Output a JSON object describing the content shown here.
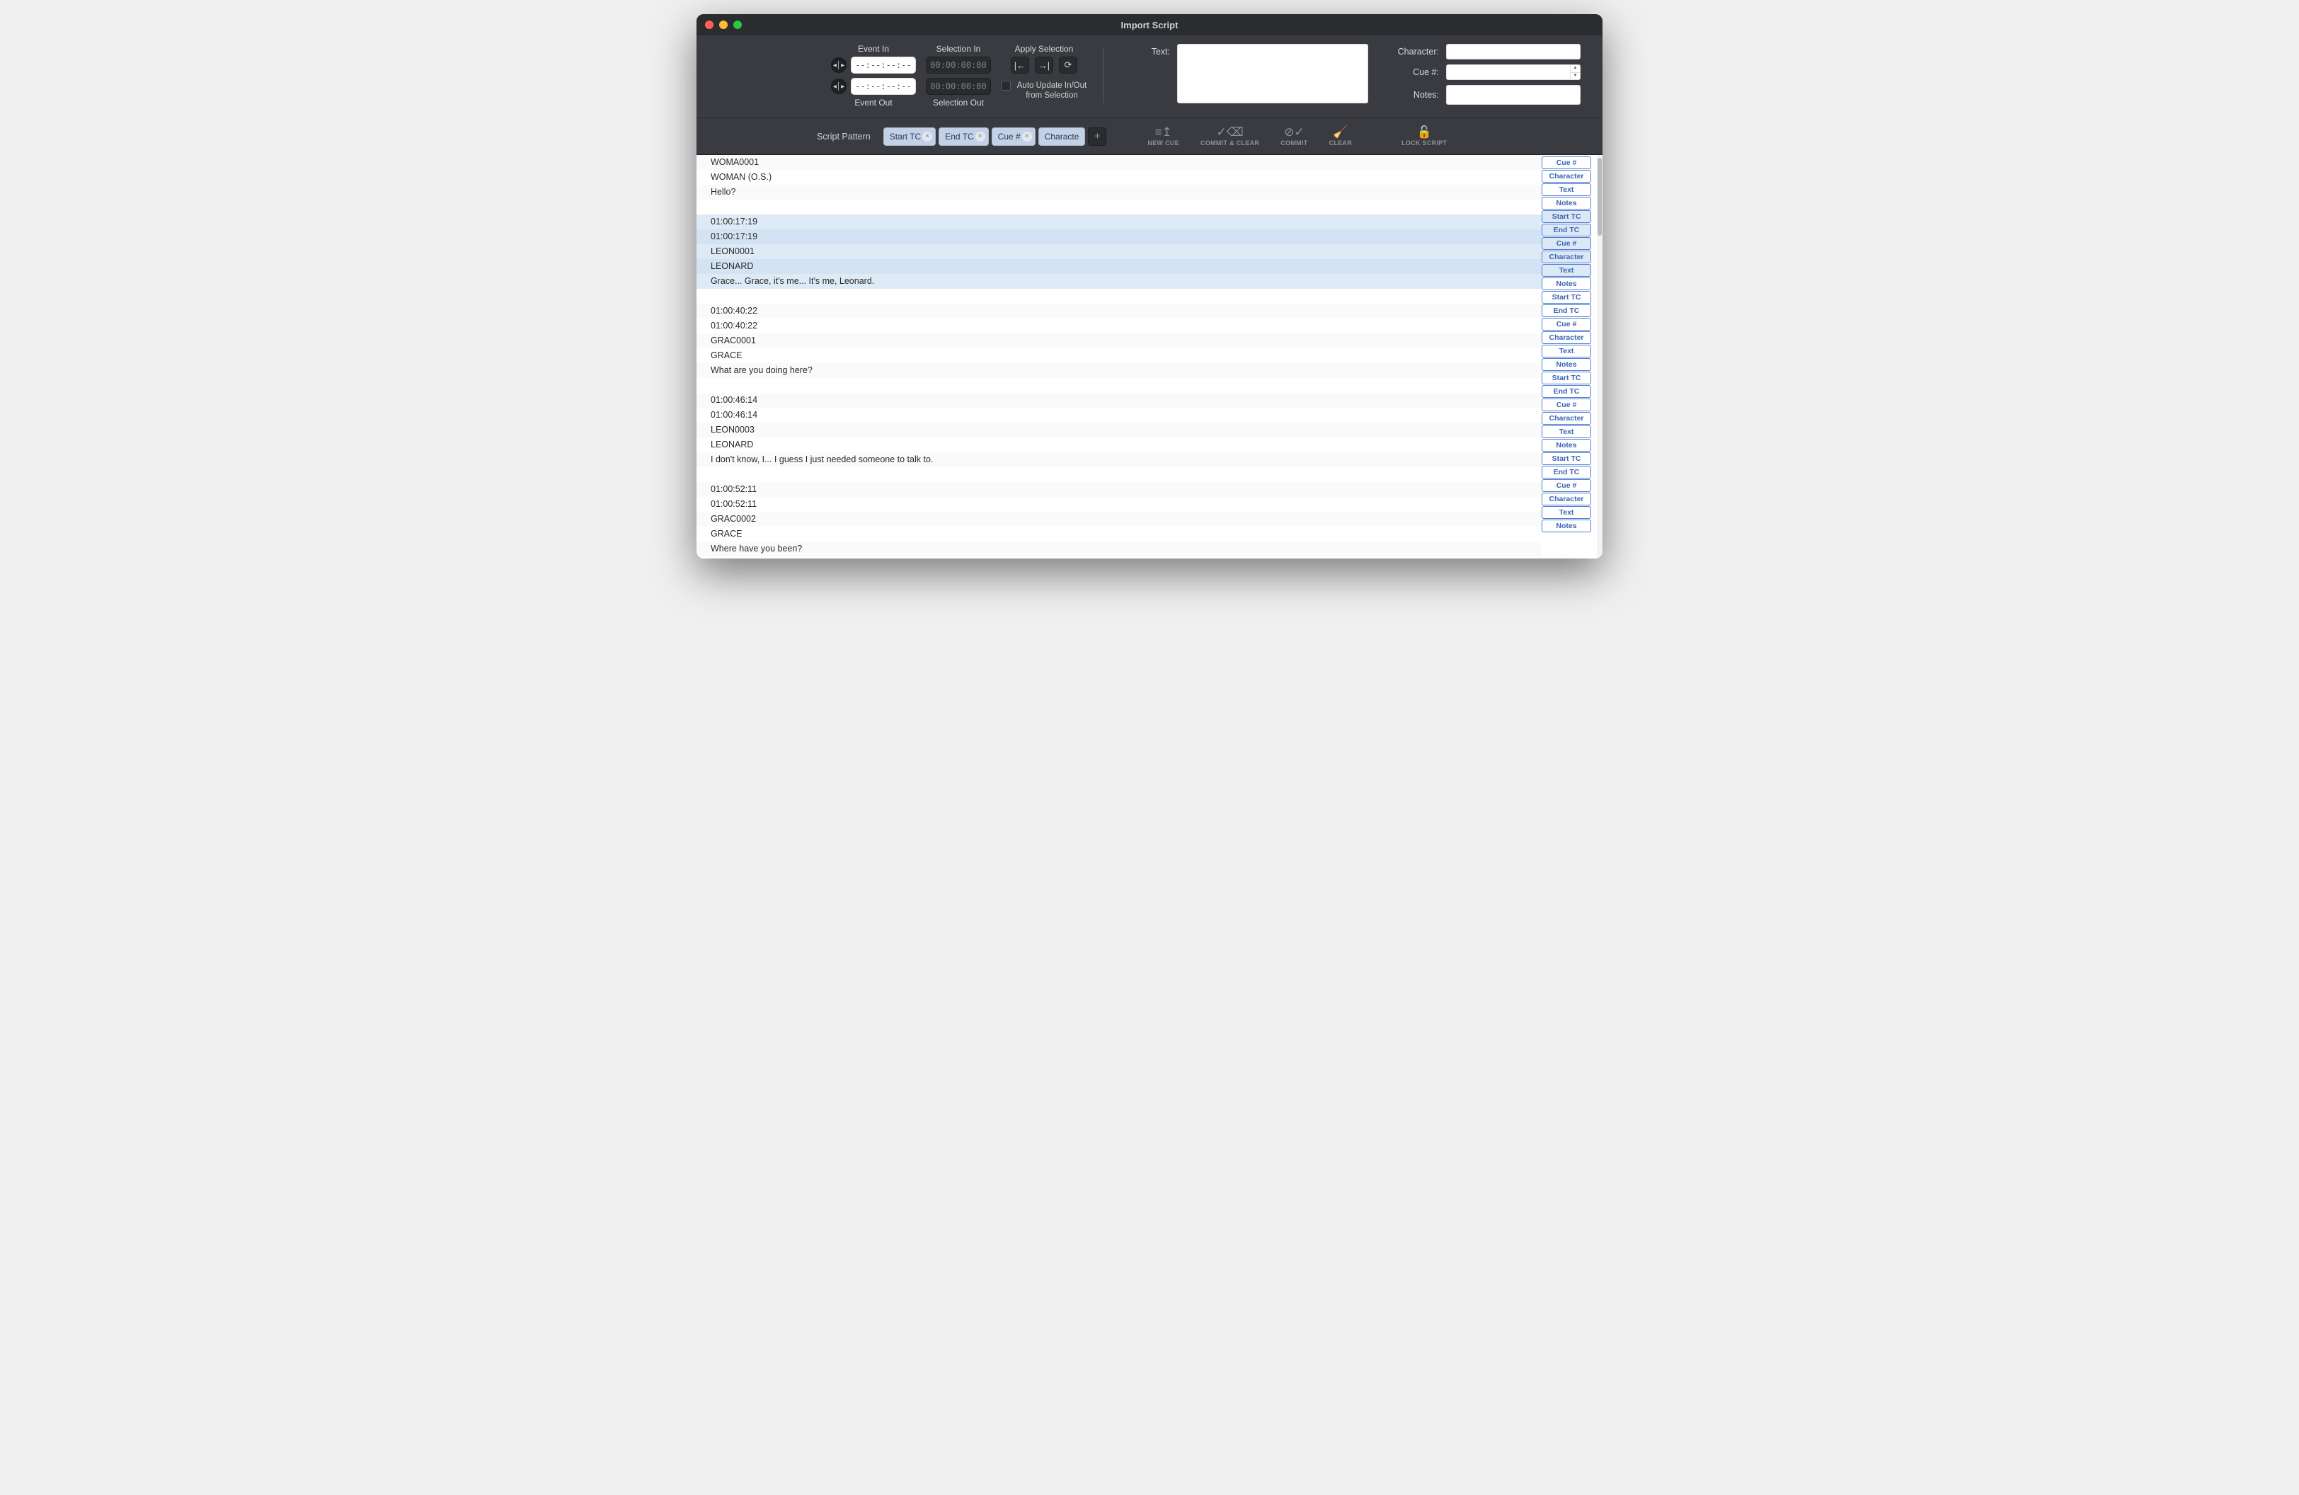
{
  "window": {
    "title": "Import Script"
  },
  "controls": {
    "event_in_label": "Event In",
    "event_out_label": "Event Out",
    "event_in_value": "--:--:--:--",
    "event_out_value": "--:--:--:--",
    "selection_in_label": "Selection In",
    "selection_out_label": "Selection Out",
    "selection_in_value": "00:00:00:00",
    "selection_out_value": "00:00:00:00",
    "apply_selection_label": "Apply Selection",
    "auto_update_label": "Auto Update In/Out from Selection",
    "text_label": "Text:",
    "character_label": "Character:",
    "cue_label": "Cue #:",
    "notes_label": "Notes:",
    "text_value": "",
    "character_value": "",
    "cue_value": "",
    "notes_value": ""
  },
  "cmdbar": {
    "pattern_label": "Script Pattern",
    "chips": [
      "Start TC",
      "End TC",
      "Cue #",
      "Characte"
    ],
    "buttons": {
      "new_cue": "NEW CUE",
      "commit_clear": "COMMIT & CLEAR",
      "commit": "COMMIT",
      "clear": "CLEAR",
      "lock": "LOCK SCRIPT"
    }
  },
  "tag_labels": [
    "Cue #",
    "Character",
    "Text",
    "Notes",
    "Start TC",
    "End TC",
    "Cue #",
    "Character",
    "Text",
    "Notes",
    "Start TC",
    "End TC",
    "Cue #",
    "Character",
    "Text",
    "Notes",
    "Start TC",
    "End TC",
    "Cue #",
    "Character",
    "Text",
    "Notes",
    "Start TC",
    "End TC",
    "Cue #",
    "Character",
    "Text",
    "Notes"
  ],
  "tag_selected_indices": [
    4,
    5,
    6,
    7,
    8
  ],
  "script_lines": [
    {
      "t": "WOMA0001"
    },
    {
      "t": "WOMAN (O.S.)"
    },
    {
      "t": "Hello?"
    },
    {
      "t": ""
    },
    {
      "t": "01:00:17:19",
      "sel": "a"
    },
    {
      "t": "01:00:17:19",
      "sel": "b"
    },
    {
      "t": "LEON0001",
      "sel": "a"
    },
    {
      "t": "LEONARD",
      "sel": "b"
    },
    {
      "t": "Grace... Grace, it's me... It's me, Leonard.",
      "sel": "a"
    },
    {
      "t": ""
    },
    {
      "t": "01:00:40:22"
    },
    {
      "t": "01:00:40:22"
    },
    {
      "t": "GRAC0001"
    },
    {
      "t": "GRACE"
    },
    {
      "t": "What are you doing here?"
    },
    {
      "t": ""
    },
    {
      "t": "01:00:46:14"
    },
    {
      "t": "01:00:46:14"
    },
    {
      "t": "LEON0003"
    },
    {
      "t": "LEONARD"
    },
    {
      "t": "I don't know, I... I guess I just needed someone to talk to."
    },
    {
      "t": ""
    },
    {
      "t": "01:00:52:11"
    },
    {
      "t": "01:00:52:11"
    },
    {
      "t": "GRAC0002"
    },
    {
      "t": "GRACE"
    },
    {
      "t": "Where have you been?"
    },
    {
      "t": ""
    }
  ]
}
